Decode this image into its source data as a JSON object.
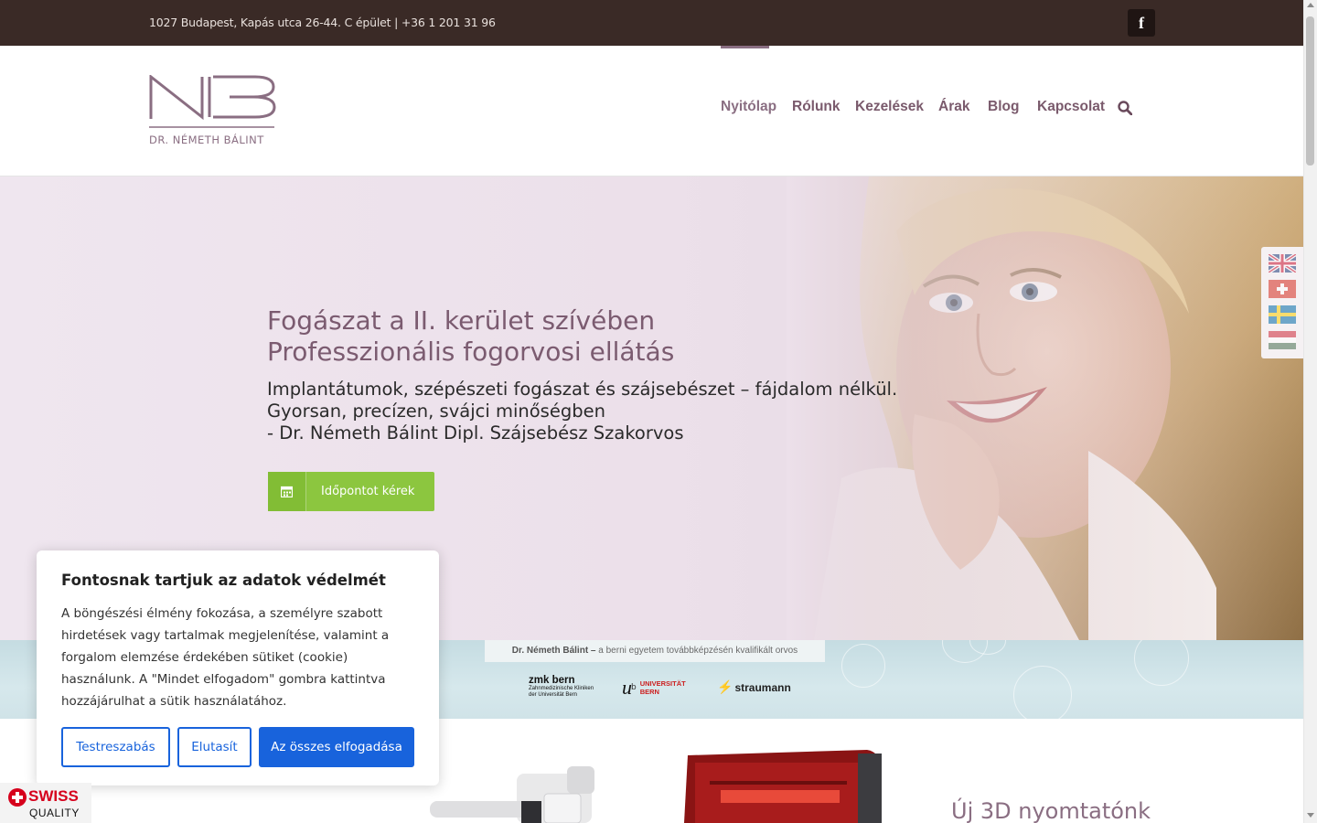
{
  "topbar": {
    "address": "1027 Budapest, Kapás utca 26-44. C épület | +36 1 201 31 96",
    "facebook_icon": "f"
  },
  "header": {
    "logo_caption": "DR. NÉMETH BÁLINT",
    "nav": [
      {
        "label": "Nyitólap",
        "active": true
      },
      {
        "label": "Rólunk"
      },
      {
        "label": "Kezelések"
      },
      {
        "label": "Árak"
      },
      {
        "label": "Blog"
      },
      {
        "label": "Kapcsolat"
      }
    ]
  },
  "hero": {
    "title_line1": "Fogászat a II. kerület szívében",
    "title_line2": "Professzionális fogorvosi ellátás",
    "sub_line1": "Implantátumok, szépészeti fogászat és szájsebészet – fájdalom nélkül.",
    "sub_line2": "Gyorsan, precízen, svájci minőségben",
    "sub_line3": "- Dr. Németh Bálint Dipl. Szájsebész Szakorvos",
    "cta_label": "Időpontot kérek"
  },
  "partners": {
    "caption_name": "Dr. Németh Bálint –",
    "caption_rest": " a berni egyetem továbbképzésén kvalifikált orvos",
    "zmk_title": "zmk bern",
    "zmk_line1": "Zahnmedizinische Kliniken",
    "zmk_line2": "der Universität Bern",
    "ub_u": "u",
    "ub_sup": "b",
    "ub_line1": "UNIVERSITÄT",
    "ub_line2": "BERN",
    "straumann": "straumann"
  },
  "below": {
    "printer_title": "Új 3D nyomtatónk"
  },
  "cookie": {
    "title": "Fontosnak tartjuk az adatok védelmét",
    "text": "A böngészési élmény fokozása, a személyre szabott hirdetések vagy tartalmak megjelenítése, valamint a forgalom elemzése érdekében sütiket (cookie) használunk. A \"Mindet elfogadom\" gombra kattintva hozzájárulhat a sütik használatához.",
    "btn_customize": "Testreszabás",
    "btn_reject": "Elutasít",
    "btn_accept": "Az összes elfogadása"
  },
  "swiss_badge": {
    "word": "SWISS",
    "quality": "QUALITY"
  },
  "language_flags": [
    "english-flag-icon",
    "swiss-flag-icon",
    "swedish-flag-icon",
    "hungarian-flag-icon"
  ],
  "colors": {
    "topbar": "#3a2a26",
    "brand": "#8a6e82",
    "cta": "#8cc63f",
    "cookie_button": "#1863dc"
  }
}
